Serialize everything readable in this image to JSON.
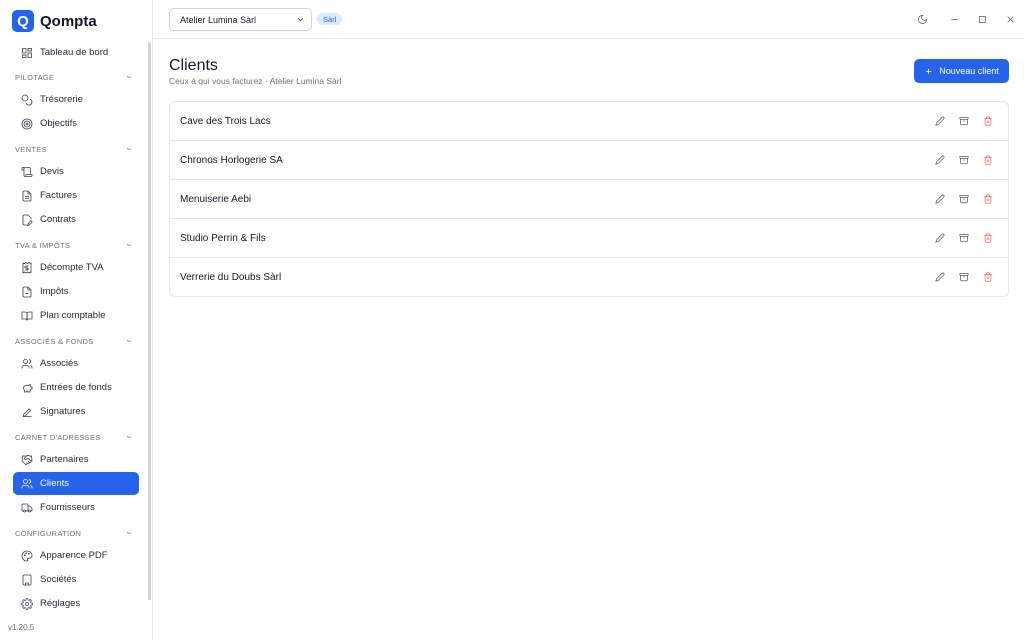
{
  "brand": {
    "name": "Qompta",
    "logo_letter": "Q"
  },
  "sidebar": {
    "items": [
      {
        "key": "dashboard",
        "label": "Tableau de bord",
        "icon": "dashboard-icon"
      },
      {
        "key": "pilotage",
        "label": "PILOTAGE",
        "section": true
      },
      {
        "key": "tresorerie",
        "label": "Trésorerie",
        "icon": "coins-icon"
      },
      {
        "key": "objectifs",
        "label": "Objectifs",
        "icon": "target-icon"
      },
      {
        "key": "ventes",
        "label": "VENTES",
        "section": true
      },
      {
        "key": "devis",
        "label": "Devis",
        "icon": "scroll-icon"
      },
      {
        "key": "factures",
        "label": "Factures",
        "icon": "file-text-icon"
      },
      {
        "key": "contrats",
        "label": "Contrats",
        "icon": "file-pen-icon"
      },
      {
        "key": "tva",
        "label": "TVA & IMPÔTS",
        "section": true
      },
      {
        "key": "decompte-tva",
        "label": "Décompte TVA",
        "icon": "receipt-icon"
      },
      {
        "key": "impots",
        "label": "Impôts",
        "icon": "file-icon"
      },
      {
        "key": "plan-comptable",
        "label": "Plan comptable",
        "icon": "book-icon"
      },
      {
        "key": "associes-fonds",
        "label": "ASSOCIÉS & FONDS",
        "section": true
      },
      {
        "key": "associes",
        "label": "Associés",
        "icon": "users-icon"
      },
      {
        "key": "entrees-fonds",
        "label": "Entrées de fonds",
        "icon": "piggy-bank-icon"
      },
      {
        "key": "signatures",
        "label": "Signatures",
        "icon": "signature-icon"
      },
      {
        "key": "carnet",
        "label": "CARNET D'ADRESSES",
        "section": true
      },
      {
        "key": "partenaires",
        "label": "Partenaires",
        "icon": "handshake-icon"
      },
      {
        "key": "clients",
        "label": "Clients",
        "icon": "users-icon",
        "active": true
      },
      {
        "key": "fournisseurs",
        "label": "Fournisseurs",
        "icon": "truck-icon"
      },
      {
        "key": "configuration",
        "label": "CONFIGURATION",
        "section": true
      },
      {
        "key": "apparence-pdf",
        "label": "Apparence PDF",
        "icon": "palette-icon"
      },
      {
        "key": "societes",
        "label": "Sociétés",
        "icon": "building-icon"
      },
      {
        "key": "reglages",
        "label": "Réglages",
        "icon": "gear-icon"
      }
    ],
    "version": "v1.20.5"
  },
  "topbar": {
    "company_select_value": "Atelier Lumina Sàrl",
    "company_badge": "Sàrl"
  },
  "page": {
    "title": "Clients",
    "subtitle": "Ceux à qui vous facturez · Atelier Lumina Sàrl",
    "new_button_label": "Nouveau client"
  },
  "clients": [
    {
      "name": "Cave des Trois Lacs"
    },
    {
      "name": "Chronos Horlogerie SA"
    },
    {
      "name": "Menuiserie Aebi"
    },
    {
      "name": "Studio Perrin & Fils"
    },
    {
      "name": "Verrerie du Doubs Sàrl"
    }
  ],
  "colors": {
    "accent": "#2563eb",
    "danger": "#ef4444",
    "badge_bg": "#dbeafe"
  }
}
